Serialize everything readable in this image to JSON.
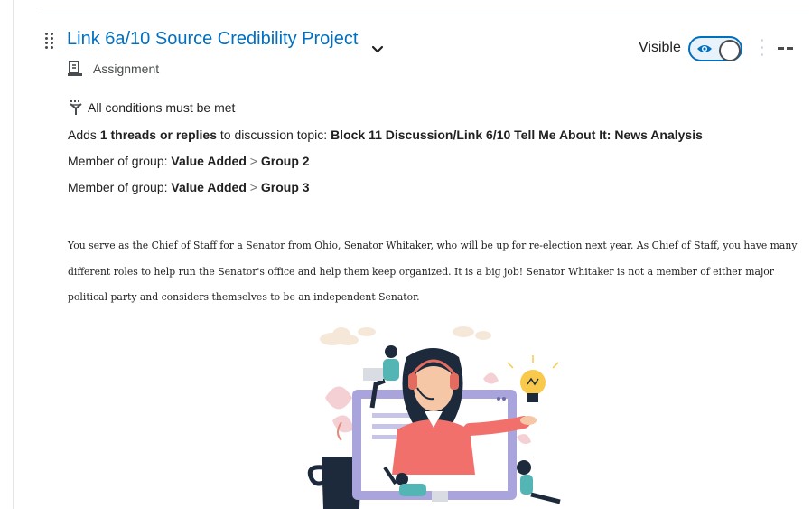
{
  "item": {
    "title": "Link 6a/10 Source Credibility Project",
    "type": "Assignment",
    "visibility_label": "Visible",
    "visibility_on": true,
    "dash": "--"
  },
  "conditions": {
    "header": "All conditions must be met",
    "c1": {
      "prefix": "Adds",
      "count": "1 threads or replies",
      "middle": "to discussion topic:",
      "target": "Block 11 Discussion/Link 6/10 Tell Me About It:  News Analysis"
    },
    "c2": {
      "prefix": "Member of group:",
      "group": "Value Added",
      "sep": ">",
      "sub": "Group 2"
    },
    "c3": {
      "prefix": "Member of group:",
      "group": "Value Added",
      "sep": ">",
      "sub": "Group 3"
    }
  },
  "description": "You serve as the Chief of Staff for a Senator from Ohio, Senator Whitaker,  who will be up for re-election next year. As Chief of Staff, you have many different roles to help run the Senator's office and help them keep organized. It is a big job! Senator Whitaker is not a member of either major political party and considers themselves to be an independent Senator.",
  "colors": {
    "link": "#006fbf",
    "text": "#202122",
    "muted": "#494c4e",
    "toggle_border": "#006fbf"
  },
  "icons": [
    "drag-handle-icon",
    "chevron-down-icon",
    "assignment-icon",
    "eye-icon",
    "more-options-icon",
    "conditions-icon"
  ]
}
